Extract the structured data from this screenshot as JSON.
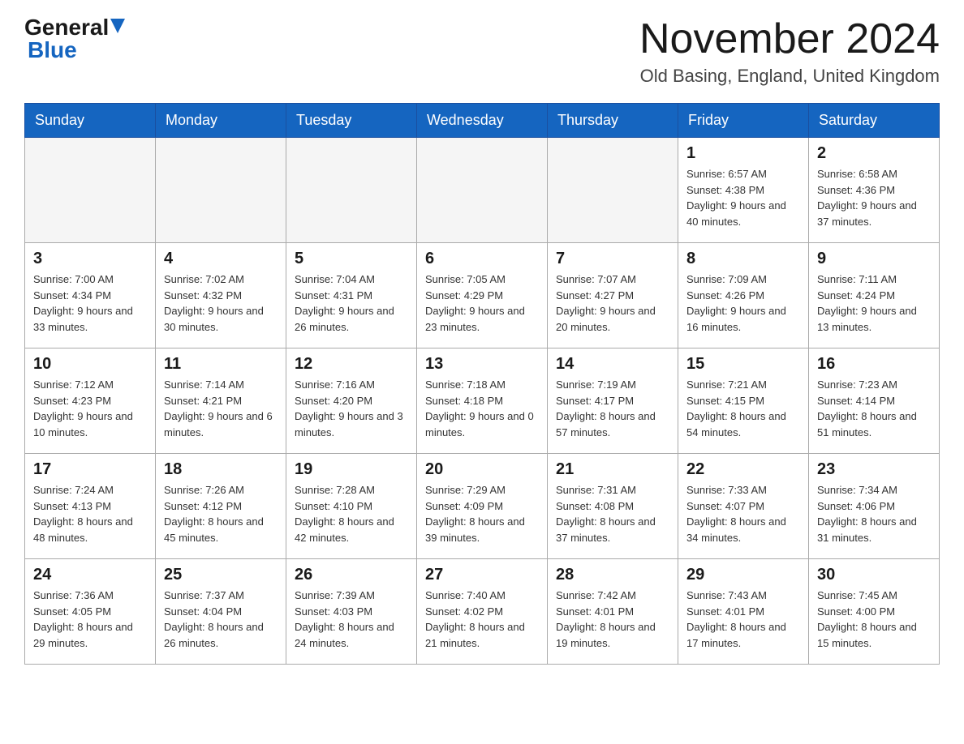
{
  "header": {
    "logo": {
      "general": "General",
      "blue": "Blue",
      "triangle_label": "logo-triangle"
    },
    "title": "November 2024",
    "location": "Old Basing, England, United Kingdom"
  },
  "weekdays": [
    "Sunday",
    "Monday",
    "Tuesday",
    "Wednesday",
    "Thursday",
    "Friday",
    "Saturday"
  ],
  "weeks": [
    [
      {
        "day": "",
        "empty": true
      },
      {
        "day": "",
        "empty": true
      },
      {
        "day": "",
        "empty": true
      },
      {
        "day": "",
        "empty": true
      },
      {
        "day": "",
        "empty": true
      },
      {
        "day": "1",
        "sunrise": "6:57 AM",
        "sunset": "4:38 PM",
        "daylight": "9 hours and 40 minutes."
      },
      {
        "day": "2",
        "sunrise": "6:58 AM",
        "sunset": "4:36 PM",
        "daylight": "9 hours and 37 minutes."
      }
    ],
    [
      {
        "day": "3",
        "sunrise": "7:00 AM",
        "sunset": "4:34 PM",
        "daylight": "9 hours and 33 minutes."
      },
      {
        "day": "4",
        "sunrise": "7:02 AM",
        "sunset": "4:32 PM",
        "daylight": "9 hours and 30 minutes."
      },
      {
        "day": "5",
        "sunrise": "7:04 AM",
        "sunset": "4:31 PM",
        "daylight": "9 hours and 26 minutes."
      },
      {
        "day": "6",
        "sunrise": "7:05 AM",
        "sunset": "4:29 PM",
        "daylight": "9 hours and 23 minutes."
      },
      {
        "day": "7",
        "sunrise": "7:07 AM",
        "sunset": "4:27 PM",
        "daylight": "9 hours and 20 minutes."
      },
      {
        "day": "8",
        "sunrise": "7:09 AM",
        "sunset": "4:26 PM",
        "daylight": "9 hours and 16 minutes."
      },
      {
        "day": "9",
        "sunrise": "7:11 AM",
        "sunset": "4:24 PM",
        "daylight": "9 hours and 13 minutes."
      }
    ],
    [
      {
        "day": "10",
        "sunrise": "7:12 AM",
        "sunset": "4:23 PM",
        "daylight": "9 hours and 10 minutes."
      },
      {
        "day": "11",
        "sunrise": "7:14 AM",
        "sunset": "4:21 PM",
        "daylight": "9 hours and 6 minutes."
      },
      {
        "day": "12",
        "sunrise": "7:16 AM",
        "sunset": "4:20 PM",
        "daylight": "9 hours and 3 minutes."
      },
      {
        "day": "13",
        "sunrise": "7:18 AM",
        "sunset": "4:18 PM",
        "daylight": "9 hours and 0 minutes."
      },
      {
        "day": "14",
        "sunrise": "7:19 AM",
        "sunset": "4:17 PM",
        "daylight": "8 hours and 57 minutes."
      },
      {
        "day": "15",
        "sunrise": "7:21 AM",
        "sunset": "4:15 PM",
        "daylight": "8 hours and 54 minutes."
      },
      {
        "day": "16",
        "sunrise": "7:23 AM",
        "sunset": "4:14 PM",
        "daylight": "8 hours and 51 minutes."
      }
    ],
    [
      {
        "day": "17",
        "sunrise": "7:24 AM",
        "sunset": "4:13 PM",
        "daylight": "8 hours and 48 minutes."
      },
      {
        "day": "18",
        "sunrise": "7:26 AM",
        "sunset": "4:12 PM",
        "daylight": "8 hours and 45 minutes."
      },
      {
        "day": "19",
        "sunrise": "7:28 AM",
        "sunset": "4:10 PM",
        "daylight": "8 hours and 42 minutes."
      },
      {
        "day": "20",
        "sunrise": "7:29 AM",
        "sunset": "4:09 PM",
        "daylight": "8 hours and 39 minutes."
      },
      {
        "day": "21",
        "sunrise": "7:31 AM",
        "sunset": "4:08 PM",
        "daylight": "8 hours and 37 minutes."
      },
      {
        "day": "22",
        "sunrise": "7:33 AM",
        "sunset": "4:07 PM",
        "daylight": "8 hours and 34 minutes."
      },
      {
        "day": "23",
        "sunrise": "7:34 AM",
        "sunset": "4:06 PM",
        "daylight": "8 hours and 31 minutes."
      }
    ],
    [
      {
        "day": "24",
        "sunrise": "7:36 AM",
        "sunset": "4:05 PM",
        "daylight": "8 hours and 29 minutes."
      },
      {
        "day": "25",
        "sunrise": "7:37 AM",
        "sunset": "4:04 PM",
        "daylight": "8 hours and 26 minutes."
      },
      {
        "day": "26",
        "sunrise": "7:39 AM",
        "sunset": "4:03 PM",
        "daylight": "8 hours and 24 minutes."
      },
      {
        "day": "27",
        "sunrise": "7:40 AM",
        "sunset": "4:02 PM",
        "daylight": "8 hours and 21 minutes."
      },
      {
        "day": "28",
        "sunrise": "7:42 AM",
        "sunset": "4:01 PM",
        "daylight": "8 hours and 19 minutes."
      },
      {
        "day": "29",
        "sunrise": "7:43 AM",
        "sunset": "4:01 PM",
        "daylight": "8 hours and 17 minutes."
      },
      {
        "day": "30",
        "sunrise": "7:45 AM",
        "sunset": "4:00 PM",
        "daylight": "8 hours and 15 minutes."
      }
    ]
  ]
}
